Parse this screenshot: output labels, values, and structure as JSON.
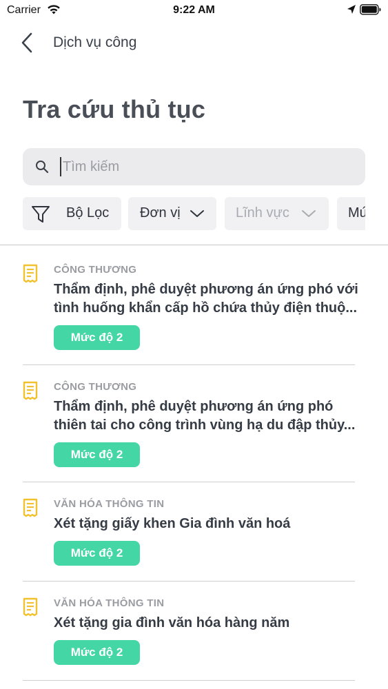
{
  "status_bar": {
    "carrier": "Carrier",
    "time": "9:22 AM"
  },
  "nav": {
    "back_icon": "chevron-left-icon",
    "title": "Dịch vụ công"
  },
  "page_title": "Tra cứu thủ tục",
  "search": {
    "placeholder": "Tìm kiếm",
    "value": ""
  },
  "filters": {
    "filter_label": "Bộ Lọc",
    "chips": [
      {
        "label": "Đơn vị",
        "enabled": true
      },
      {
        "label": "Lĩnh vực",
        "enabled": false
      },
      {
        "label": "Mứ",
        "enabled": true
      }
    ]
  },
  "procedures": [
    {
      "category": "CÔNG THƯƠNG",
      "title_line1": "Thẩm định, phê duyệt phương án ứng phó với",
      "title_line2": "tình huống khẩn cấp hồ chứa thủy điện thuộ...",
      "level": "Mức độ 2"
    },
    {
      "category": "CÔNG THƯƠNG",
      "title_line1": "Thẩm định, phê duyệt phương án ứng phó",
      "title_line2": "thiên tai cho công trình vùng hạ du đập thủy...",
      "level": "Mức độ 2"
    },
    {
      "category": "VĂN HÓA THÔNG TIN",
      "title_line1": "Xét tặng giấy khen Gia đình văn hoá",
      "title_line2": "",
      "level": "Mức độ 2"
    },
    {
      "category": "VĂN HÓA THÔNG TIN",
      "title_line1": "Xét tặng gia đình văn hóa hàng năm",
      "title_line2": "",
      "level": "Mức độ 2"
    }
  ],
  "colors": {
    "badge": "#45d6a6",
    "doc_icon": "#f2c12e",
    "search_bg": "#ebebee"
  }
}
